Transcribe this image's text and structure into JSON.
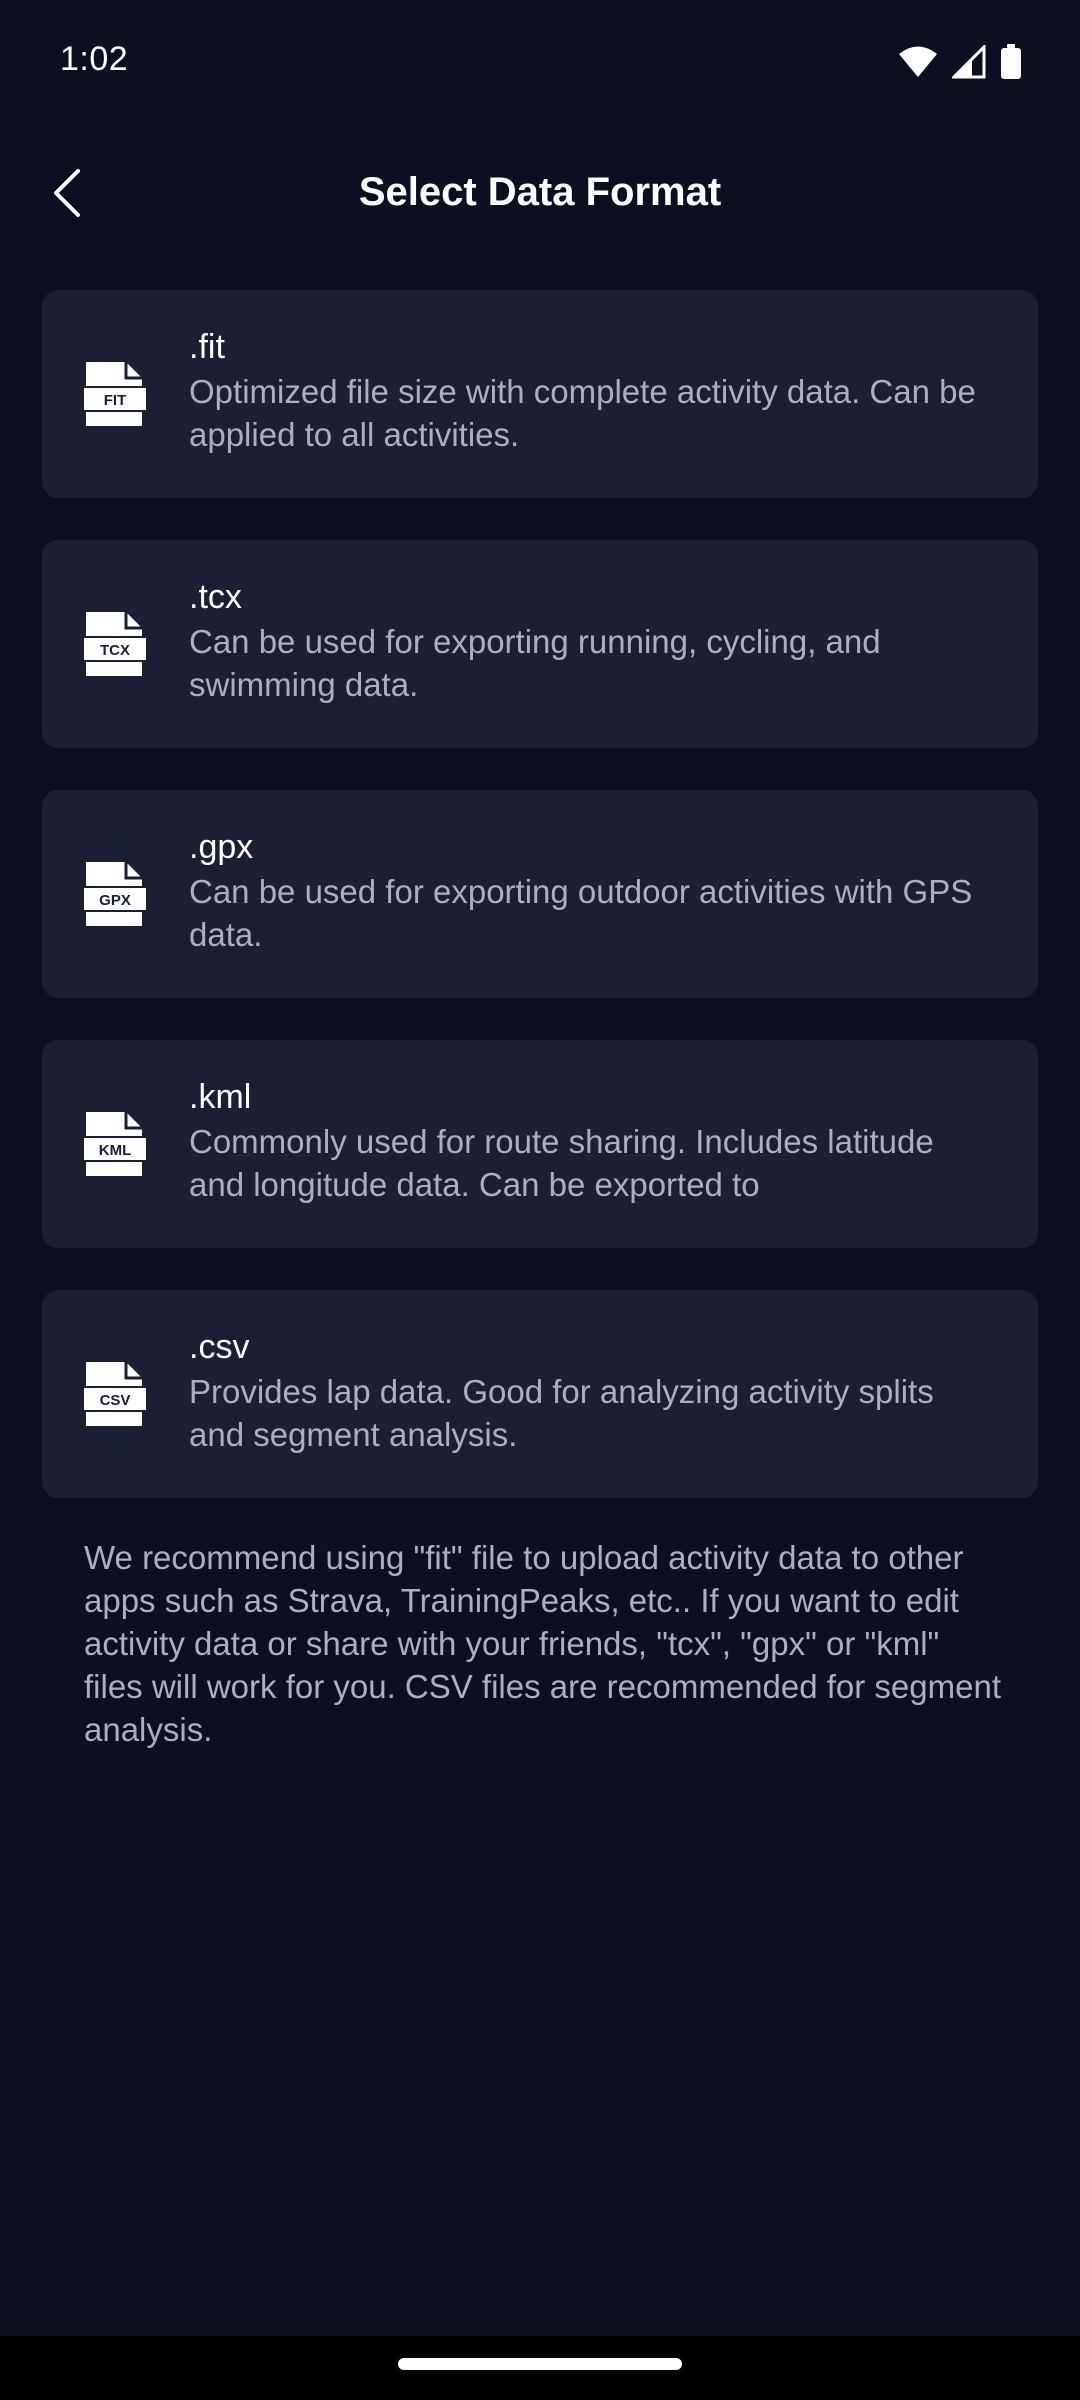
{
  "status_bar": {
    "time": "1:02",
    "icons": [
      "wifi-icon",
      "cellular-signal-icon",
      "battery-icon"
    ]
  },
  "header": {
    "title": "Select Data Format",
    "back_icon": "chevron-left-icon"
  },
  "formats": [
    {
      "name": ".fit",
      "icon_label": "FIT",
      "description": "Optimized file size with complete activity data. Can be applied to all activities."
    },
    {
      "name": ".tcx",
      "icon_label": "TCX",
      "description": "Can be used for exporting running, cycling, and swimming data."
    },
    {
      "name": ".gpx",
      "icon_label": "GPX",
      "description": "Can be used for exporting outdoor activities with GPS data."
    },
    {
      "name": ".kml",
      "icon_label": "KML",
      "description": "Commonly used for route sharing. Includes latitude and longitude data. Can be exported to"
    },
    {
      "name": ".csv",
      "icon_label": "CSV",
      "description": "Provides lap data. Good for analyzing activity splits and segment analysis."
    }
  ],
  "footer_note": "We recommend using \"fit\" file to upload activity data to other apps such as Strava, TrainingPeaks, etc.. If you want to edit activity data or share with your friends, \"tcx\", \"gpx\" or \"kml\" files will work for you. CSV files are recommended for segment analysis.",
  "colors": {
    "background": "#0b0f22",
    "card": "#1a1f33",
    "primary_text": "#ffffff",
    "secondary_text": "#aab0c0"
  }
}
